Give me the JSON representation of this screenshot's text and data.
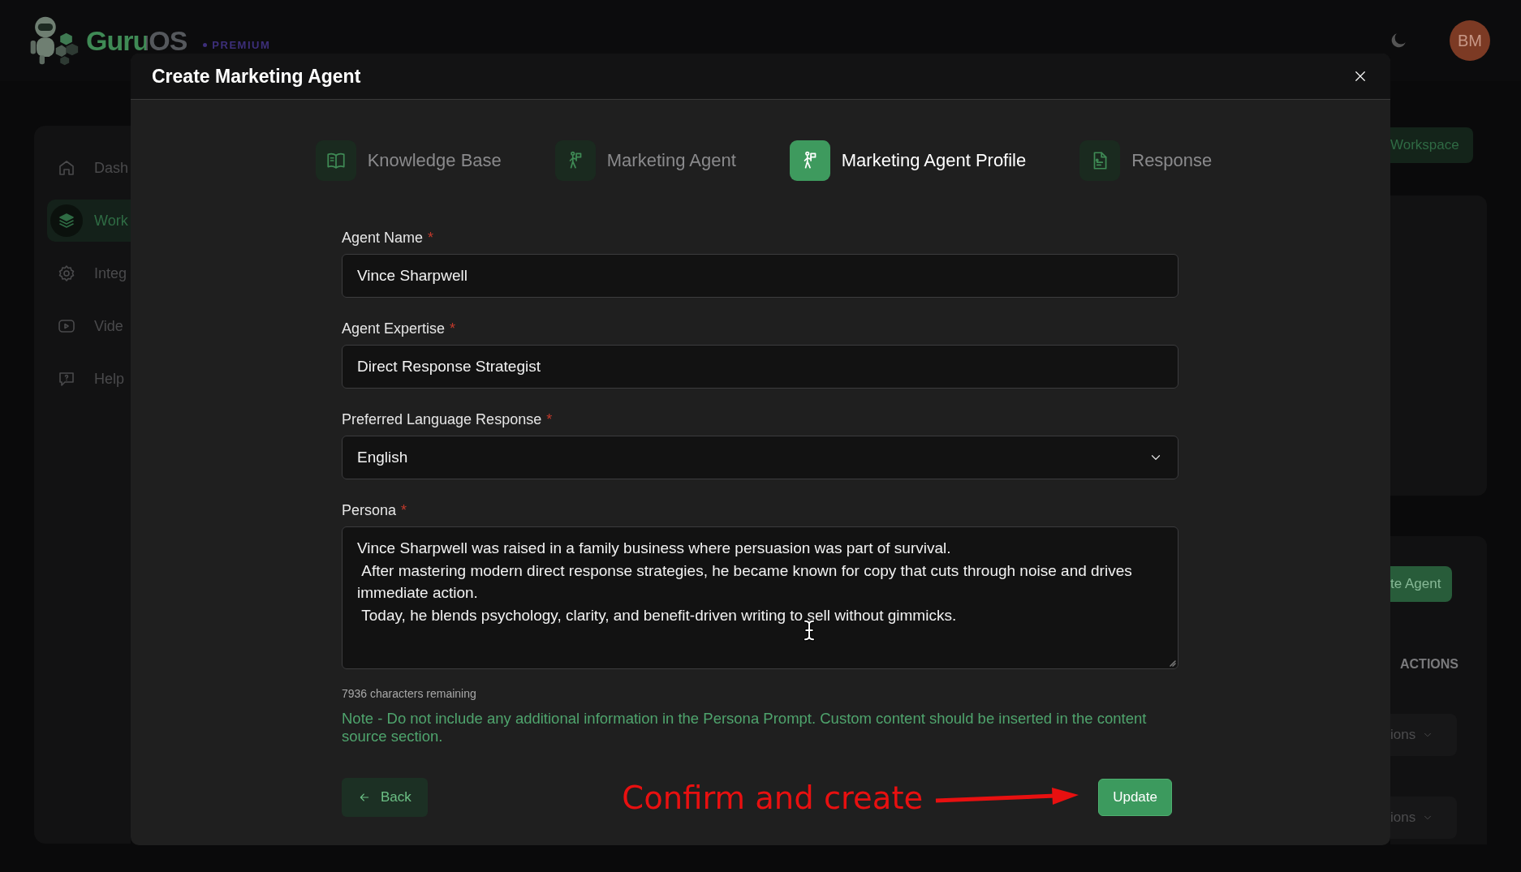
{
  "header": {
    "logo": "GuruOS",
    "plan": "PREMIUM",
    "avatar": "BM"
  },
  "sidebar": {
    "items": [
      {
        "label": "Dash",
        "kind": "home",
        "selected": false
      },
      {
        "label": "Work",
        "kind": "layers",
        "selected": true
      },
      {
        "label": "Integ",
        "kind": "gear",
        "selected": false
      },
      {
        "label": "Vide",
        "kind": "video",
        "selected": false
      },
      {
        "label": "Help",
        "kind": "help",
        "selected": false
      }
    ]
  },
  "background": {
    "workspace_button": "Workspace",
    "create_button": "te Agent",
    "column_header": "ACTIONS",
    "action_menus": [
      "ions",
      "ions"
    ]
  },
  "modal": {
    "title": "Create Marketing Agent",
    "steps": [
      {
        "label": "Knowledge Base",
        "kind": "book",
        "selected": false
      },
      {
        "label": "Marketing Agent",
        "kind": "figure",
        "selected": false
      },
      {
        "label": "Marketing Agent Profile",
        "kind": "figure",
        "selected": true
      },
      {
        "label": "Response",
        "kind": "document",
        "selected": false
      }
    ],
    "fields": [
      {
        "kind": "text",
        "label": "Agent Name",
        "required_mark": "*",
        "value": "Vince Sharpwell"
      },
      {
        "kind": "text",
        "label": "Agent Expertise",
        "required_mark": "*",
        "value": "Direct Response Strategist"
      },
      {
        "kind": "select",
        "label": "Preferred Language Response",
        "required_mark": "*",
        "value": "English"
      },
      {
        "kind": "textarea",
        "label": "Persona",
        "required_mark": "*",
        "value": "Vince Sharpwell was raised in a family business where persuasion was part of survival.\n After mastering modern direct response strategies, he became known for copy that cuts through noise and drives immediate action.\n Today, he blends psychology, clarity, and benefit-driven writing to sell without gimmicks."
      }
    ],
    "counter": "7936 characters remaining",
    "note": "Note - Do not include any additional information in the Persona Prompt. Custom content should be inserted in the content source section.",
    "back_button": "Back",
    "update_button": "Update",
    "annotation": "Confirm and create"
  }
}
